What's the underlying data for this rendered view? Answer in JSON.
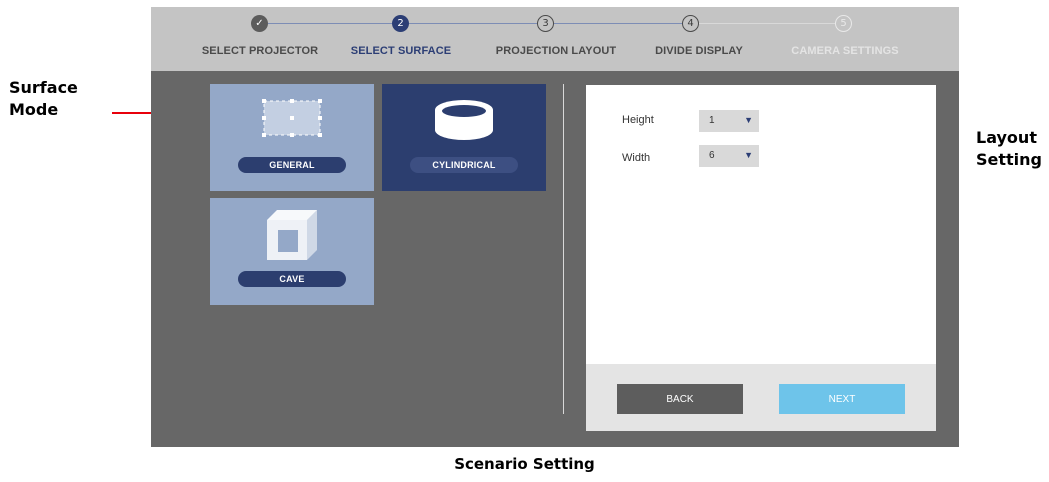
{
  "annotations": {
    "surface_mode": "Surface\nMode",
    "layout_setting": "Layout\nSetting",
    "caption": "Scenario Setting"
  },
  "stepper": {
    "steps": [
      {
        "number": "✓",
        "label": "SELECT PROJECTOR",
        "state": "done"
      },
      {
        "number": "2",
        "label": "SELECT SURFACE",
        "state": "active"
      },
      {
        "number": "3",
        "label": "PROJECTION LAYOUT",
        "state": "todo"
      },
      {
        "number": "4",
        "label": "DIVIDE DISPLAY",
        "state": "todo"
      },
      {
        "number": "5",
        "label": "CAMERA SETTINGS",
        "state": "disabled"
      }
    ]
  },
  "surfaces": {
    "general": {
      "label": "GENERAL",
      "icon": "grid-plane-icon",
      "selected": false
    },
    "cylindrical": {
      "label": "CYLINDRICAL",
      "icon": "cylinder-icon",
      "selected": true
    },
    "cave": {
      "label": "CAVE",
      "icon": "cube-icon",
      "selected": false
    }
  },
  "layout": {
    "height_label": "Height",
    "height_value": "1",
    "width_label": "Width",
    "width_value": "6",
    "dropdown_icon": "triangle-down-icon",
    "back_label": "BACK",
    "next_label": "NEXT"
  },
  "colors": {
    "accent": "#2c3e75",
    "annotation": "#e8000b",
    "next_button": "#6ec4ea",
    "back_button": "#5d5d5d"
  }
}
